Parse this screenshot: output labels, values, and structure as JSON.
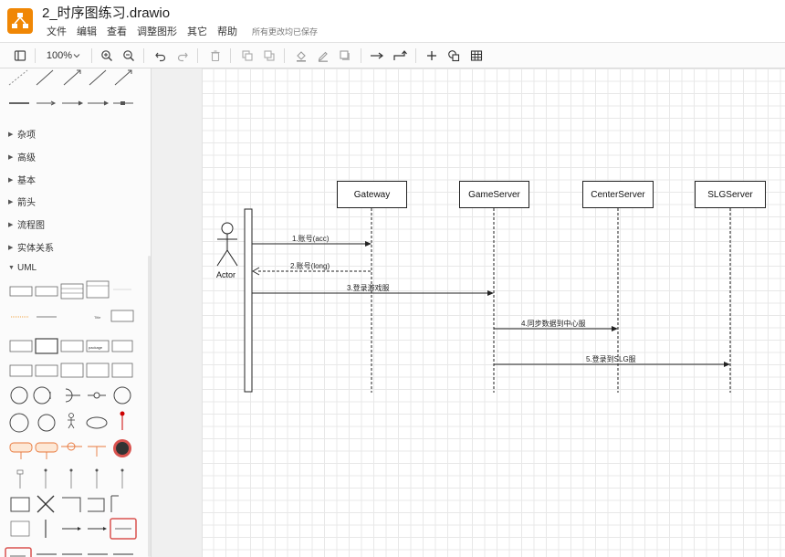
{
  "app": {
    "title": "2_时序图练习.drawio",
    "save_status": "所有更改均已保存",
    "brand_color": "#f08705"
  },
  "menu": [
    "文件",
    "编辑",
    "查看",
    "调整图形",
    "其它",
    "帮助"
  ],
  "toolbar": {
    "zoom": "100%",
    "icons": [
      "sidebar-toggle-icon",
      "zoom-in-icon",
      "zoom-out-icon",
      "undo-icon",
      "redo-icon",
      "delete-icon",
      "to-front-icon",
      "to-back-icon",
      "fill-color-icon",
      "line-color-icon",
      "shadow-icon",
      "connection-arrow-icon",
      "waypoints-icon",
      "insert-plus-icon",
      "shapes-icon",
      "table-icon"
    ]
  },
  "sidebar": {
    "sections": [
      "杂项",
      "高级",
      "基本",
      "箭头",
      "流程图",
      "实体关系",
      "UML"
    ],
    "expanded": "UML"
  },
  "diagram": {
    "lifelines": [
      "Gateway",
      "GameServer",
      "CenterServer",
      "SLGServer"
    ],
    "actor": "Actor",
    "messages": [
      "1.账号(acc)",
      "2.账号(long)",
      "3.登录游戏服",
      "4.同步数据到中心服",
      "5.登录到SLG服"
    ]
  }
}
